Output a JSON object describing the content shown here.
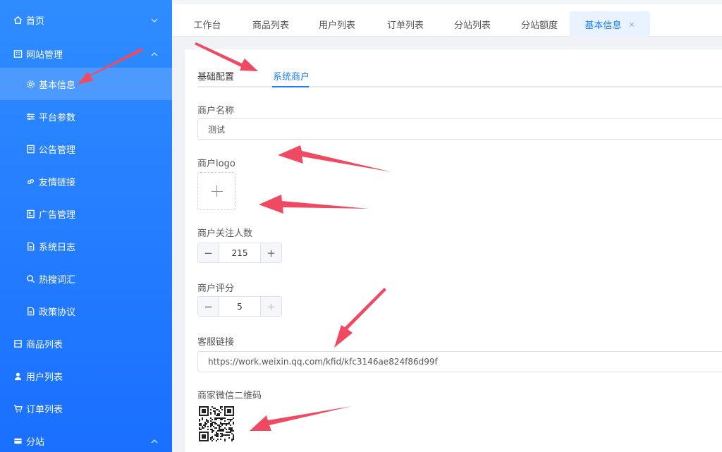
{
  "colors": {
    "accent": "#1a7cff",
    "sidebar": "#2580ff",
    "arrow": "#f04a63"
  },
  "sidebar": {
    "items": [
      {
        "label": "首页",
        "icon": "home-icon"
      },
      {
        "label": "网站管理",
        "icon": "building-icon"
      },
      {
        "label": "基本信息",
        "icon": "gear-icon"
      },
      {
        "label": "平台参数",
        "icon": "sliders-icon"
      },
      {
        "label": "公告管理",
        "icon": "notice-icon"
      },
      {
        "label": "友情链接",
        "icon": "link-icon"
      },
      {
        "label": "广告管理",
        "icon": "ad-icon"
      },
      {
        "label": "系统日志",
        "icon": "log-icon"
      },
      {
        "label": "热搜词汇",
        "icon": "search-icon"
      },
      {
        "label": "政策协议",
        "icon": "document-icon"
      },
      {
        "label": "商品列表",
        "icon": "product-icon"
      },
      {
        "label": "用户列表",
        "icon": "user-icon"
      },
      {
        "label": "订单列表",
        "icon": "cart-icon"
      },
      {
        "label": "分站",
        "icon": "branch-icon"
      }
    ]
  },
  "tabs": [
    {
      "label": "工作台"
    },
    {
      "label": "商品列表"
    },
    {
      "label": "用户列表"
    },
    {
      "label": "订单列表"
    },
    {
      "label": "分站列表"
    },
    {
      "label": "分站额度"
    },
    {
      "label": "基本信息",
      "close": "×"
    }
  ],
  "inner_tabs": [
    {
      "label": "基础配置"
    },
    {
      "label": "系统商户"
    }
  ],
  "form": {
    "merchant_name": {
      "label": "商户名称",
      "value": "测试"
    },
    "merchant_logo": {
      "label": "商户logo"
    },
    "followers": {
      "label": "商户关注人数",
      "value": "215",
      "minus": "−",
      "plus": "+"
    },
    "rating": {
      "label": "商户评分",
      "value": "5",
      "minus": "−",
      "plus": "+"
    },
    "service_link": {
      "label": "客服链接",
      "value": "https://work.weixin.qq.com/kfid/kfc3146ae824f86d99f"
    },
    "wechat_qr": {
      "label": "商家微信二维码"
    }
  }
}
